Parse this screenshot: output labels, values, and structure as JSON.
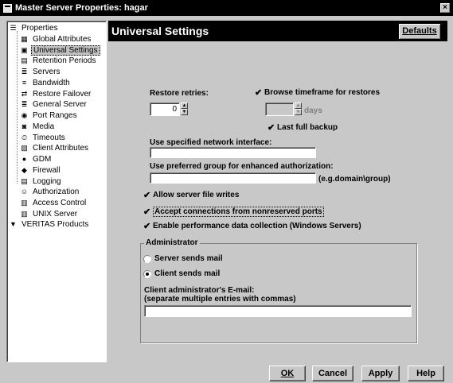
{
  "window": {
    "title": "Master Server Properties: hagar"
  },
  "tree": {
    "items": [
      {
        "label": "Properties",
        "icon": "properties-icon",
        "glyph": "☰",
        "level": 0,
        "selected": false
      },
      {
        "label": "Global Attributes",
        "icon": "global-attributes-icon",
        "glyph": "▦",
        "level": 1,
        "selected": false
      },
      {
        "label": "Universal Settings",
        "icon": "universal-settings-icon",
        "glyph": "▣",
        "level": 1,
        "selected": true
      },
      {
        "label": "Retention Periods",
        "icon": "retention-periods-icon",
        "glyph": "▤",
        "level": 1,
        "selected": false
      },
      {
        "label": "Servers",
        "icon": "servers-icon",
        "glyph": "≣",
        "level": 1,
        "selected": false
      },
      {
        "label": "Bandwidth",
        "icon": "bandwidth-icon",
        "glyph": "≡",
        "level": 1,
        "selected": false
      },
      {
        "label": "Restore Failover",
        "icon": "restore-failover-icon",
        "glyph": "⇄",
        "level": 1,
        "selected": false
      },
      {
        "label": "General Server",
        "icon": "general-server-icon",
        "glyph": "≣",
        "level": 1,
        "selected": false
      },
      {
        "label": "Port Ranges",
        "icon": "port-ranges-icon",
        "glyph": "◉",
        "level": 1,
        "selected": false
      },
      {
        "label": "Media",
        "icon": "media-icon",
        "glyph": "◙",
        "level": 1,
        "selected": false
      },
      {
        "label": "Timeouts",
        "icon": "timeouts-icon",
        "glyph": "⏲",
        "level": 1,
        "selected": false
      },
      {
        "label": "Client Attributes",
        "icon": "client-attributes-icon",
        "glyph": "▧",
        "level": 1,
        "selected": false
      },
      {
        "label": "GDM",
        "icon": "gdm-icon",
        "glyph": "●",
        "level": 1,
        "selected": false
      },
      {
        "label": "Firewall",
        "icon": "firewall-icon",
        "glyph": "◆",
        "level": 1,
        "selected": false
      },
      {
        "label": "Logging",
        "icon": "logging-icon",
        "glyph": "▤",
        "level": 1,
        "selected": false
      },
      {
        "label": "Authorization",
        "icon": "authorization-icon",
        "glyph": "☺",
        "level": 1,
        "selected": false
      },
      {
        "label": "Access Control",
        "icon": "access-control-icon",
        "glyph": "▥",
        "level": 1,
        "selected": false
      },
      {
        "label": "UNIX Server",
        "icon": "unix-server-icon",
        "glyph": "▥",
        "level": 1,
        "selected": false
      },
      {
        "label": "VERITAS Products",
        "icon": "veritas-products-icon",
        "glyph": "▼",
        "level": 0,
        "selected": false
      }
    ]
  },
  "header": {
    "title": "Universal Settings",
    "defaults_label": "Defaults"
  },
  "form": {
    "restore_retries_label": "Restore retries:",
    "restore_retries_value": "0",
    "browse_timeframe_label": "Browse timeframe for restores",
    "browse_timeframe_checked": true,
    "days_value": "",
    "days_label": "days",
    "last_full_backup_label": "Last full backup",
    "last_full_backup_checked": true,
    "network_interface_label": "Use specified network interface:",
    "network_interface_value": "",
    "preferred_group_label": "Use preferred group for enhanced authorization:",
    "preferred_group_value": "",
    "preferred_group_hint": "(e.g.domain\\group)",
    "allow_writes_label": "Allow server file writes",
    "allow_writes_checked": true,
    "nonreserved_label": "Accept connections from nonreserved ports",
    "nonreserved_checked": true,
    "perf_data_label": "Enable performance data collection (Windows Servers)",
    "perf_data_checked": true
  },
  "administrator": {
    "legend": "Administrator",
    "server_sends_mail_label": "Server sends mail",
    "client_sends_mail_label": "Client sends mail",
    "selected": "client",
    "email_label_line1": "Client administrator's E-mail:",
    "email_label_line2": "(separate multiple entries with commas)",
    "email_value": ""
  },
  "buttons": {
    "ok": "OK",
    "cancel": "Cancel",
    "apply": "Apply",
    "help": "Help"
  },
  "glyphs": {
    "check": "✔",
    "spin_up": "▲",
    "spin_down": "▼",
    "close": "×"
  }
}
